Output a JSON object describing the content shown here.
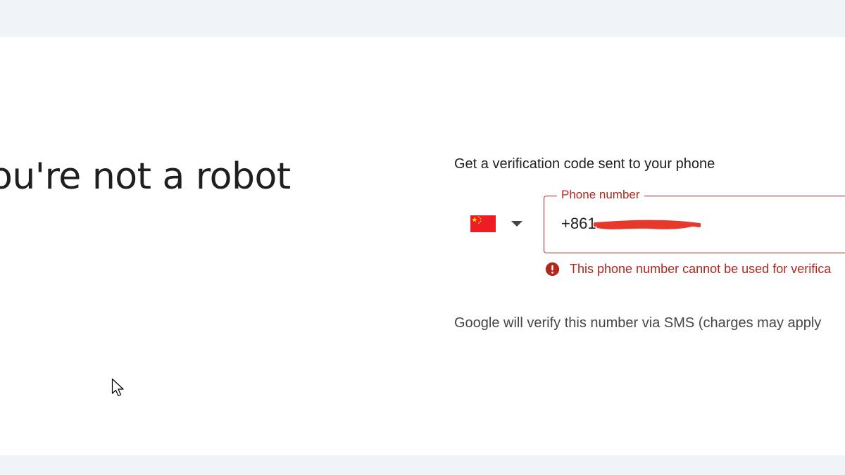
{
  "heading": "ou're not a robot",
  "phone_section": {
    "prompt": "Get a verification code sent to your phone",
    "country": {
      "flag_icon": "china-flag-icon",
      "dropdown_icon": "caret-down-icon"
    },
    "field": {
      "label": "Phone number",
      "value": "+861"
    },
    "error": {
      "icon": "error-circle-icon",
      "text": "This phone number cannot be used for verifica"
    },
    "note": "Google will verify this number via SMS (charges may apply"
  },
  "colors": {
    "error": "#b3261e",
    "page_background": "#f0f4f9",
    "card_background": "#ffffff",
    "redaction": "#e8382b",
    "flag_red": "#ee1c25",
    "flag_yellow": "#ffde00"
  }
}
